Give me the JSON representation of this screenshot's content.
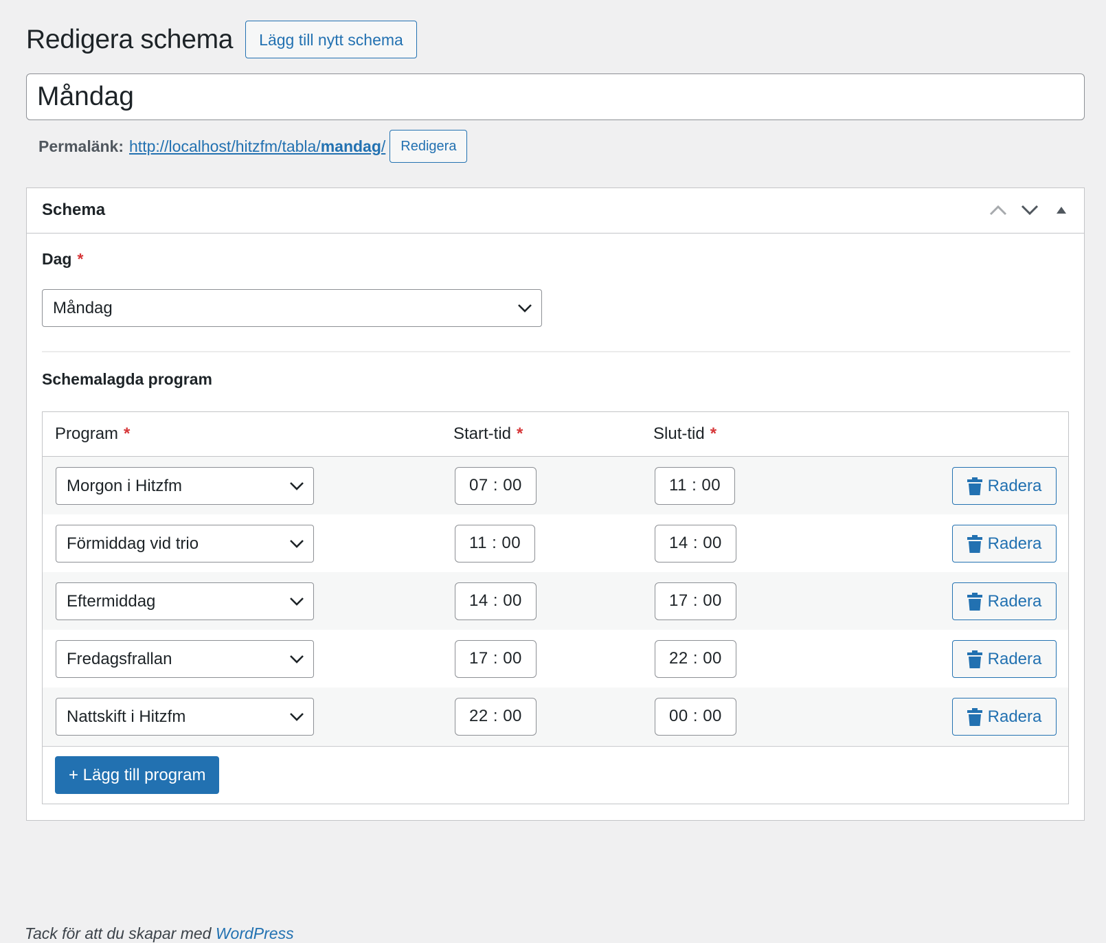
{
  "header": {
    "title": "Redigera schema",
    "add_new_label": "Lägg till nytt schema"
  },
  "post_title": {
    "value": "Måndag"
  },
  "permalink": {
    "label": "Permalänk:",
    "url_prefix": "http://localhost/hitzfm/tabla/",
    "slug": "mandag",
    "url_suffix": "/",
    "edit_label": "Redigera"
  },
  "metabox": {
    "title": "Schema",
    "controls": [
      "chevron-up-icon",
      "chevron-down-icon",
      "toggle-arrow-icon"
    ],
    "day_label": "Dag",
    "required_mark": "*",
    "day_value": "Måndag",
    "programs_label": "Schemalagda program",
    "columns": {
      "program": "Program",
      "start": "Start-tid",
      "end": "Slut-tid"
    },
    "rows": [
      {
        "program": "Morgon i Hitzfm",
        "start": "07 : 00",
        "end": "11 : 00",
        "delete_label": "Radera"
      },
      {
        "program": "Förmiddag vid trio",
        "start": "11 : 00",
        "end": "14 : 00",
        "delete_label": "Radera"
      },
      {
        "program": "Eftermiddag",
        "start": "14 : 00",
        "end": "17 : 00",
        "delete_label": "Radera"
      },
      {
        "program": "Fredagsfrallan",
        "start": "17 : 00",
        "end": "22 : 00",
        "delete_label": "Radera"
      },
      {
        "program": "Nattskift i Hitzfm",
        "start": "22 : 00",
        "end": "00 : 00",
        "delete_label": "Radera"
      }
    ],
    "add_program_label": "+ Lägg till program"
  },
  "footer": {
    "text_prefix": "Tack för att du skapar med ",
    "link_text": "WordPress"
  },
  "colors": {
    "accent": "#2271b1",
    "required": "#d63638",
    "background": "#f0f0f1"
  }
}
